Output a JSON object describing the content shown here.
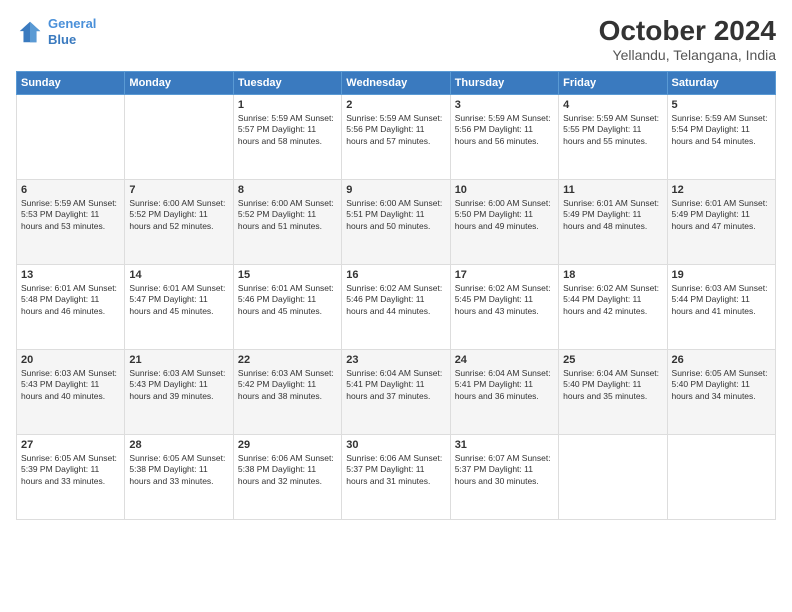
{
  "logo": {
    "line1": "General",
    "line2": "Blue"
  },
  "title": "October 2024",
  "location": "Yellandu, Telangana, India",
  "days_of_week": [
    "Sunday",
    "Monday",
    "Tuesday",
    "Wednesday",
    "Thursday",
    "Friday",
    "Saturday"
  ],
  "weeks": [
    [
      {
        "day": "",
        "info": ""
      },
      {
        "day": "",
        "info": ""
      },
      {
        "day": "1",
        "info": "Sunrise: 5:59 AM\nSunset: 5:57 PM\nDaylight: 11 hours\nand 58 minutes."
      },
      {
        "day": "2",
        "info": "Sunrise: 5:59 AM\nSunset: 5:56 PM\nDaylight: 11 hours\nand 57 minutes."
      },
      {
        "day": "3",
        "info": "Sunrise: 5:59 AM\nSunset: 5:56 PM\nDaylight: 11 hours\nand 56 minutes."
      },
      {
        "day": "4",
        "info": "Sunrise: 5:59 AM\nSunset: 5:55 PM\nDaylight: 11 hours\nand 55 minutes."
      },
      {
        "day": "5",
        "info": "Sunrise: 5:59 AM\nSunset: 5:54 PM\nDaylight: 11 hours\nand 54 minutes."
      }
    ],
    [
      {
        "day": "6",
        "info": "Sunrise: 5:59 AM\nSunset: 5:53 PM\nDaylight: 11 hours\nand 53 minutes."
      },
      {
        "day": "7",
        "info": "Sunrise: 6:00 AM\nSunset: 5:52 PM\nDaylight: 11 hours\nand 52 minutes."
      },
      {
        "day": "8",
        "info": "Sunrise: 6:00 AM\nSunset: 5:52 PM\nDaylight: 11 hours\nand 51 minutes."
      },
      {
        "day": "9",
        "info": "Sunrise: 6:00 AM\nSunset: 5:51 PM\nDaylight: 11 hours\nand 50 minutes."
      },
      {
        "day": "10",
        "info": "Sunrise: 6:00 AM\nSunset: 5:50 PM\nDaylight: 11 hours\nand 49 minutes."
      },
      {
        "day": "11",
        "info": "Sunrise: 6:01 AM\nSunset: 5:49 PM\nDaylight: 11 hours\nand 48 minutes."
      },
      {
        "day": "12",
        "info": "Sunrise: 6:01 AM\nSunset: 5:49 PM\nDaylight: 11 hours\nand 47 minutes."
      }
    ],
    [
      {
        "day": "13",
        "info": "Sunrise: 6:01 AM\nSunset: 5:48 PM\nDaylight: 11 hours\nand 46 minutes."
      },
      {
        "day": "14",
        "info": "Sunrise: 6:01 AM\nSunset: 5:47 PM\nDaylight: 11 hours\nand 45 minutes."
      },
      {
        "day": "15",
        "info": "Sunrise: 6:01 AM\nSunset: 5:46 PM\nDaylight: 11 hours\nand 45 minutes."
      },
      {
        "day": "16",
        "info": "Sunrise: 6:02 AM\nSunset: 5:46 PM\nDaylight: 11 hours\nand 44 minutes."
      },
      {
        "day": "17",
        "info": "Sunrise: 6:02 AM\nSunset: 5:45 PM\nDaylight: 11 hours\nand 43 minutes."
      },
      {
        "day": "18",
        "info": "Sunrise: 6:02 AM\nSunset: 5:44 PM\nDaylight: 11 hours\nand 42 minutes."
      },
      {
        "day": "19",
        "info": "Sunrise: 6:03 AM\nSunset: 5:44 PM\nDaylight: 11 hours\nand 41 minutes."
      }
    ],
    [
      {
        "day": "20",
        "info": "Sunrise: 6:03 AM\nSunset: 5:43 PM\nDaylight: 11 hours\nand 40 minutes."
      },
      {
        "day": "21",
        "info": "Sunrise: 6:03 AM\nSunset: 5:43 PM\nDaylight: 11 hours\nand 39 minutes."
      },
      {
        "day": "22",
        "info": "Sunrise: 6:03 AM\nSunset: 5:42 PM\nDaylight: 11 hours\nand 38 minutes."
      },
      {
        "day": "23",
        "info": "Sunrise: 6:04 AM\nSunset: 5:41 PM\nDaylight: 11 hours\nand 37 minutes."
      },
      {
        "day": "24",
        "info": "Sunrise: 6:04 AM\nSunset: 5:41 PM\nDaylight: 11 hours\nand 36 minutes."
      },
      {
        "day": "25",
        "info": "Sunrise: 6:04 AM\nSunset: 5:40 PM\nDaylight: 11 hours\nand 35 minutes."
      },
      {
        "day": "26",
        "info": "Sunrise: 6:05 AM\nSunset: 5:40 PM\nDaylight: 11 hours\nand 34 minutes."
      }
    ],
    [
      {
        "day": "27",
        "info": "Sunrise: 6:05 AM\nSunset: 5:39 PM\nDaylight: 11 hours\nand 33 minutes."
      },
      {
        "day": "28",
        "info": "Sunrise: 6:05 AM\nSunset: 5:38 PM\nDaylight: 11 hours\nand 33 minutes."
      },
      {
        "day": "29",
        "info": "Sunrise: 6:06 AM\nSunset: 5:38 PM\nDaylight: 11 hours\nand 32 minutes."
      },
      {
        "day": "30",
        "info": "Sunrise: 6:06 AM\nSunset: 5:37 PM\nDaylight: 11 hours\nand 31 minutes."
      },
      {
        "day": "31",
        "info": "Sunrise: 6:07 AM\nSunset: 5:37 PM\nDaylight: 11 hours\nand 30 minutes."
      },
      {
        "day": "",
        "info": ""
      },
      {
        "day": "",
        "info": ""
      }
    ]
  ]
}
